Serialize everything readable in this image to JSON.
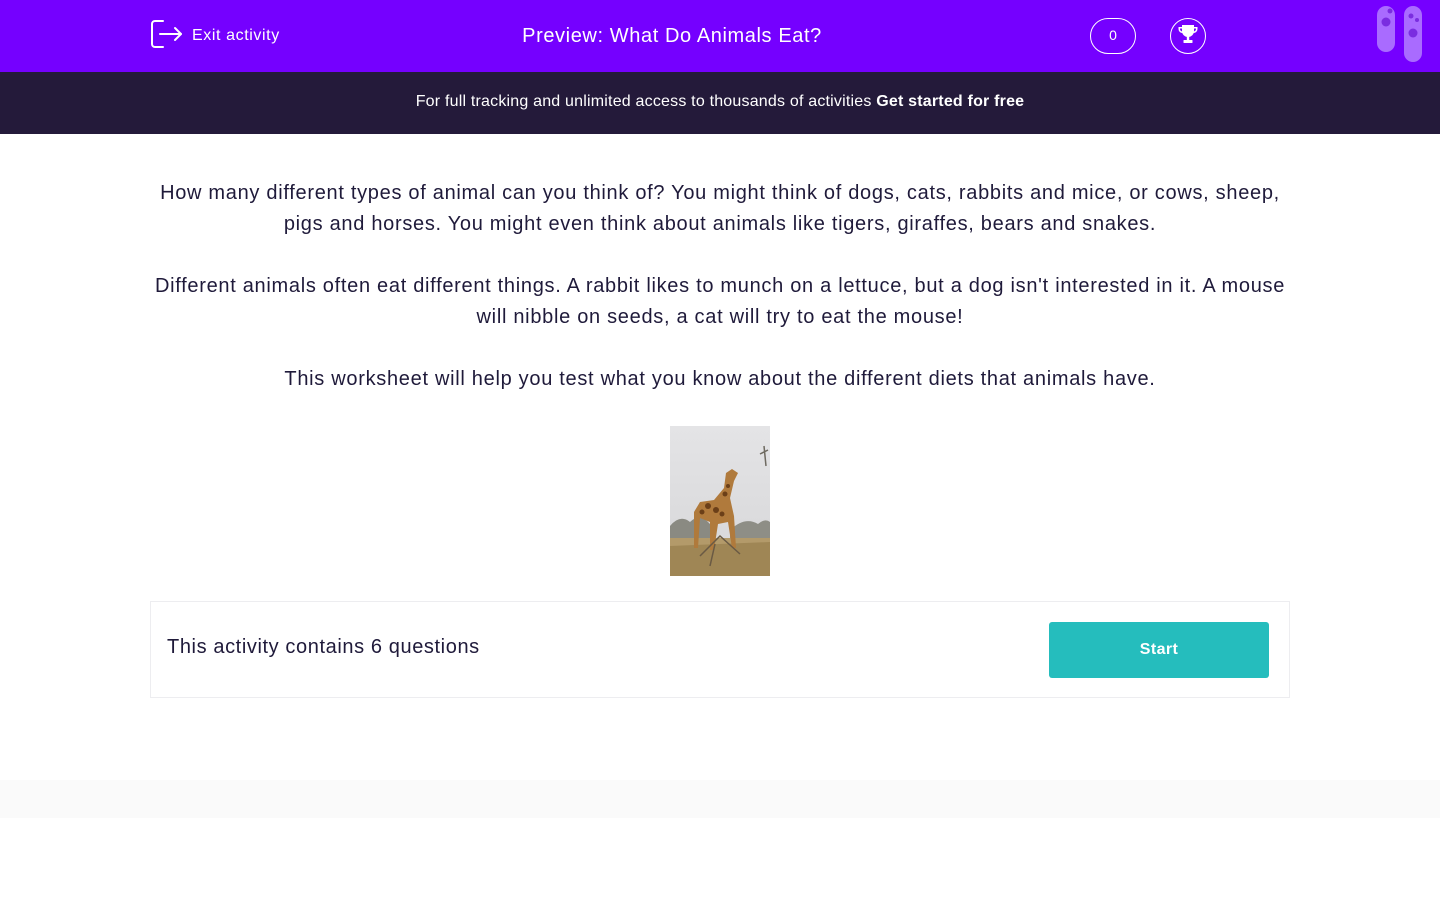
{
  "header": {
    "exit_label": "Exit activity",
    "title": "Preview: What Do Animals Eat?",
    "score": "0",
    "background_color": "#7500ff"
  },
  "banner": {
    "text": "For full tracking and unlimited access to thousands of activities ",
    "cta": "Get started for free",
    "background_color": "#241a3a"
  },
  "intro": {
    "paragraphs": [
      "How many different types of animal can you think of?  You might think of dogs, cats, rabbits and mice, or cows, sheep, pigs and horses.  You might even think about animals like tigers, giraffes, bears and snakes.",
      "Different animals often eat different things.  A rabbit likes to munch on a lettuce, but a dog isn't interested in it.  A mouse will nibble on seeds, a cat will try to eat the mouse!",
      "This worksheet will help you test what you know about the different diets that animals have."
    ]
  },
  "activity": {
    "summary": "This activity contains 6 questions",
    "start_label": "Start",
    "start_color": "#25bdbd"
  },
  "icons": {
    "exit": "exit-icon",
    "trophy": "trophy-icon",
    "logo": "test-tubes-logo-icon"
  }
}
